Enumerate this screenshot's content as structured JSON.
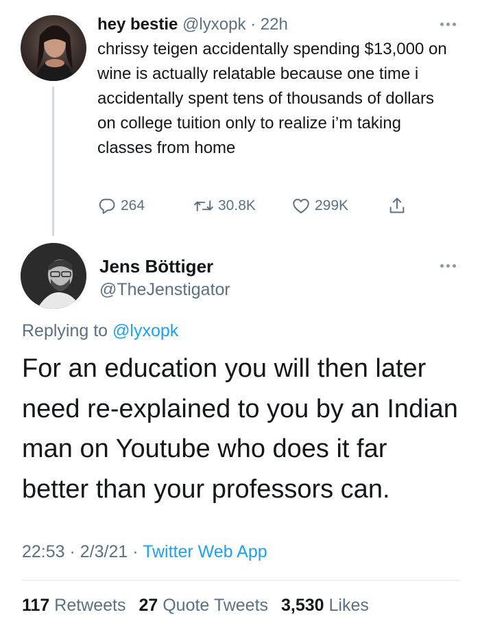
{
  "parent_tweet": {
    "display_name": "hey bestie",
    "handle": "@lyxopk",
    "separator": " · ",
    "time_ago": "22h",
    "text": "chrissy teigen accidentally spending $13,000 on wine is actually relatable because one time i accidentally spent tens of thousands of dollars on college tuition only to realize i’m taking classes from home",
    "reply_count": "264",
    "retweet_count": "30.8K",
    "like_count": "299K"
  },
  "main_tweet": {
    "display_name": "Jens Böttiger",
    "handle": "@TheJenstigator",
    "replying_to_label": "Replying to ",
    "replying_to_handle": "@lyxopk",
    "text": "For an education you will then later need re-explained to you by an Indian man on Youtube who does it far better than your professors can.",
    "time": "22:53",
    "date": "2/3/21",
    "separator": " · ",
    "source": "Twitter Web App",
    "retweets_count": "117",
    "retweets_label": " Retweets",
    "quote_tweets_count": "27",
    "quote_tweets_label": " Quote Tweets",
    "likes_count": "3,530",
    "likes_label": " Likes"
  },
  "colors": {
    "text": "#14171a",
    "secondary": "#5b7083",
    "link": "#1da1f2",
    "thread_line": "#cfd9de",
    "divider": "#e1e8ed"
  },
  "icons": [
    "more-icon",
    "reply-icon",
    "retweet-icon",
    "like-icon",
    "share-icon"
  ]
}
